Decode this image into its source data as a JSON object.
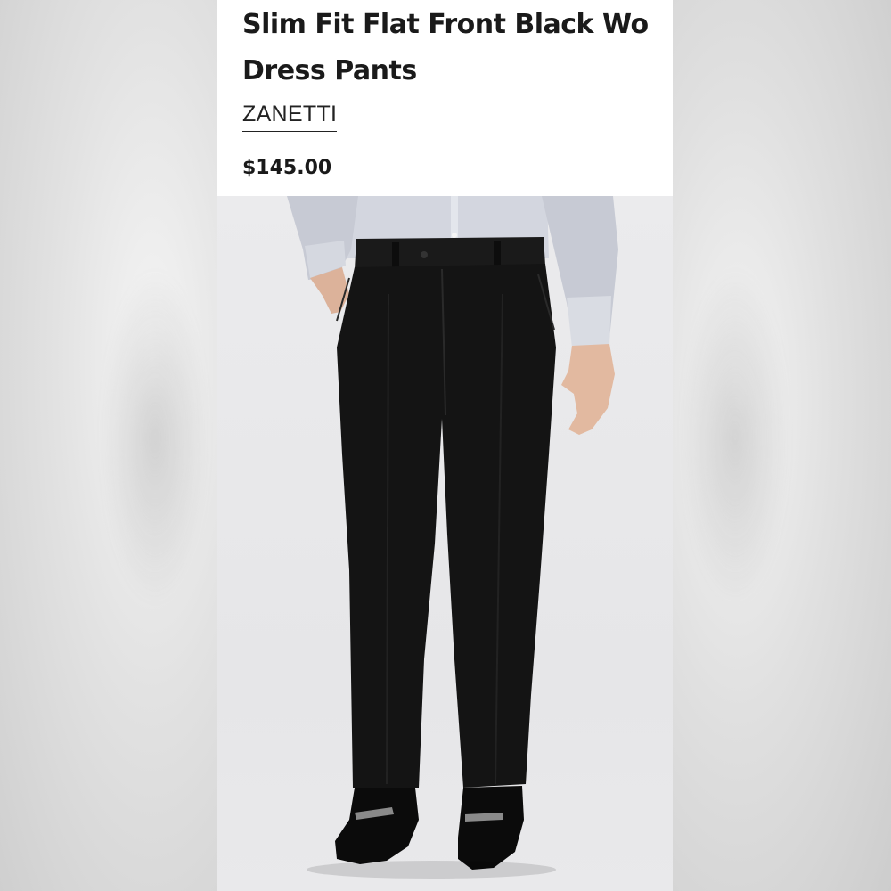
{
  "product": {
    "title_line1": "Slim Fit Flat Front Black Wo",
    "title_line2": "Dress Pants",
    "brand": "ZANETTI",
    "price": "$145.00"
  },
  "colors": {
    "text": "#1a1a1a",
    "pants": "#141414",
    "shirt": "#c9ccd6",
    "photo_bg": "#e8e8ea"
  },
  "icons": {
    "product_photo": "product-photo-black-dress-pants"
  }
}
